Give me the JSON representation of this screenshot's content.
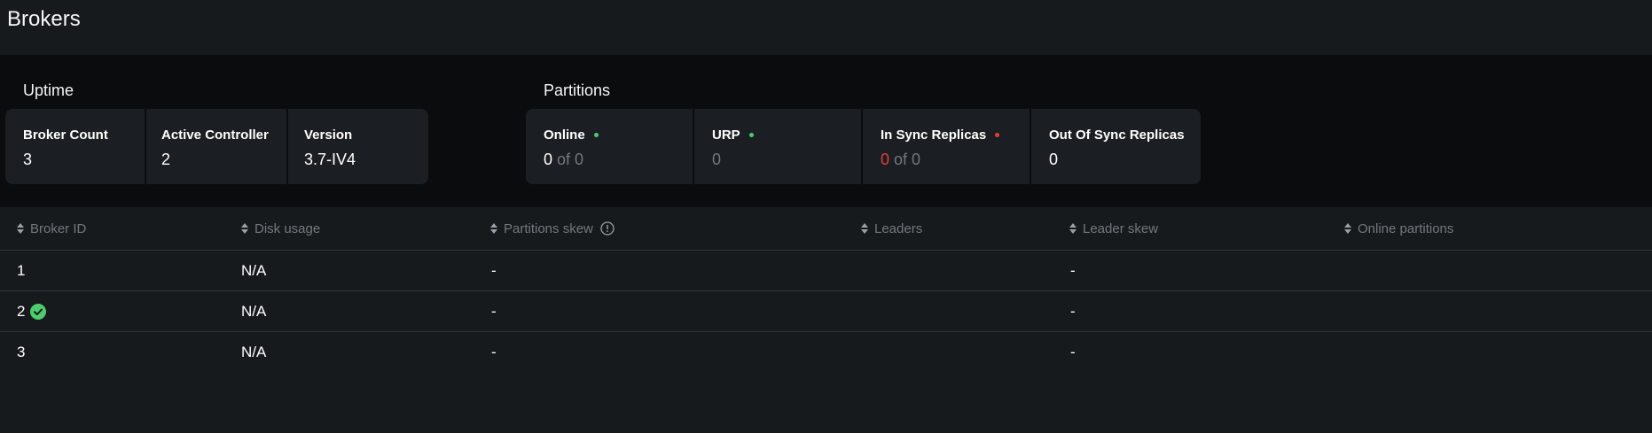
{
  "page": {
    "title": "Brokers"
  },
  "uptime": {
    "title": "Uptime",
    "cards": [
      {
        "label": "Broker Count",
        "value": "3"
      },
      {
        "label": "Active Controller",
        "value": "2"
      },
      {
        "label": "Version",
        "value": "3.7-IV4"
      }
    ]
  },
  "partitions": {
    "title": "Partitions",
    "cards": [
      {
        "label": "Online",
        "value": "0",
        "of_text": "of 0",
        "status_color": "#4ccc6e"
      },
      {
        "label": "URP",
        "value": "0",
        "status_color": "#4ccc6e"
      },
      {
        "label": "In Sync Replicas",
        "value": "0",
        "of_text": "of 0",
        "status_color": "#e53b3b"
      },
      {
        "label": "Out Of Sync Replicas",
        "value": "0"
      }
    ]
  },
  "table": {
    "columns": [
      "Broker ID",
      "Disk usage",
      "Partitions skew",
      "Leaders",
      "Leader skew",
      "Online partitions"
    ],
    "rows": [
      {
        "broker_id": "1",
        "controller": false,
        "disk_usage": "N/A",
        "partitions_skew": "-",
        "leaders": "",
        "leader_skew": "-",
        "online_partitions": ""
      },
      {
        "broker_id": "2",
        "controller": true,
        "disk_usage": "N/A",
        "partitions_skew": "-",
        "leaders": "",
        "leader_skew": "-",
        "online_partitions": ""
      },
      {
        "broker_id": "3",
        "controller": false,
        "disk_usage": "N/A",
        "partitions_skew": "-",
        "leaders": "",
        "leader_skew": "-",
        "online_partitions": ""
      }
    ]
  },
  "colors": {
    "accent_green": "#4ccc6e",
    "accent_red": "#e53b3b",
    "muted": "#73787e"
  },
  "icons": {
    "sort": "sort-icon",
    "info": "info-icon",
    "controller": "check-circle-icon"
  }
}
